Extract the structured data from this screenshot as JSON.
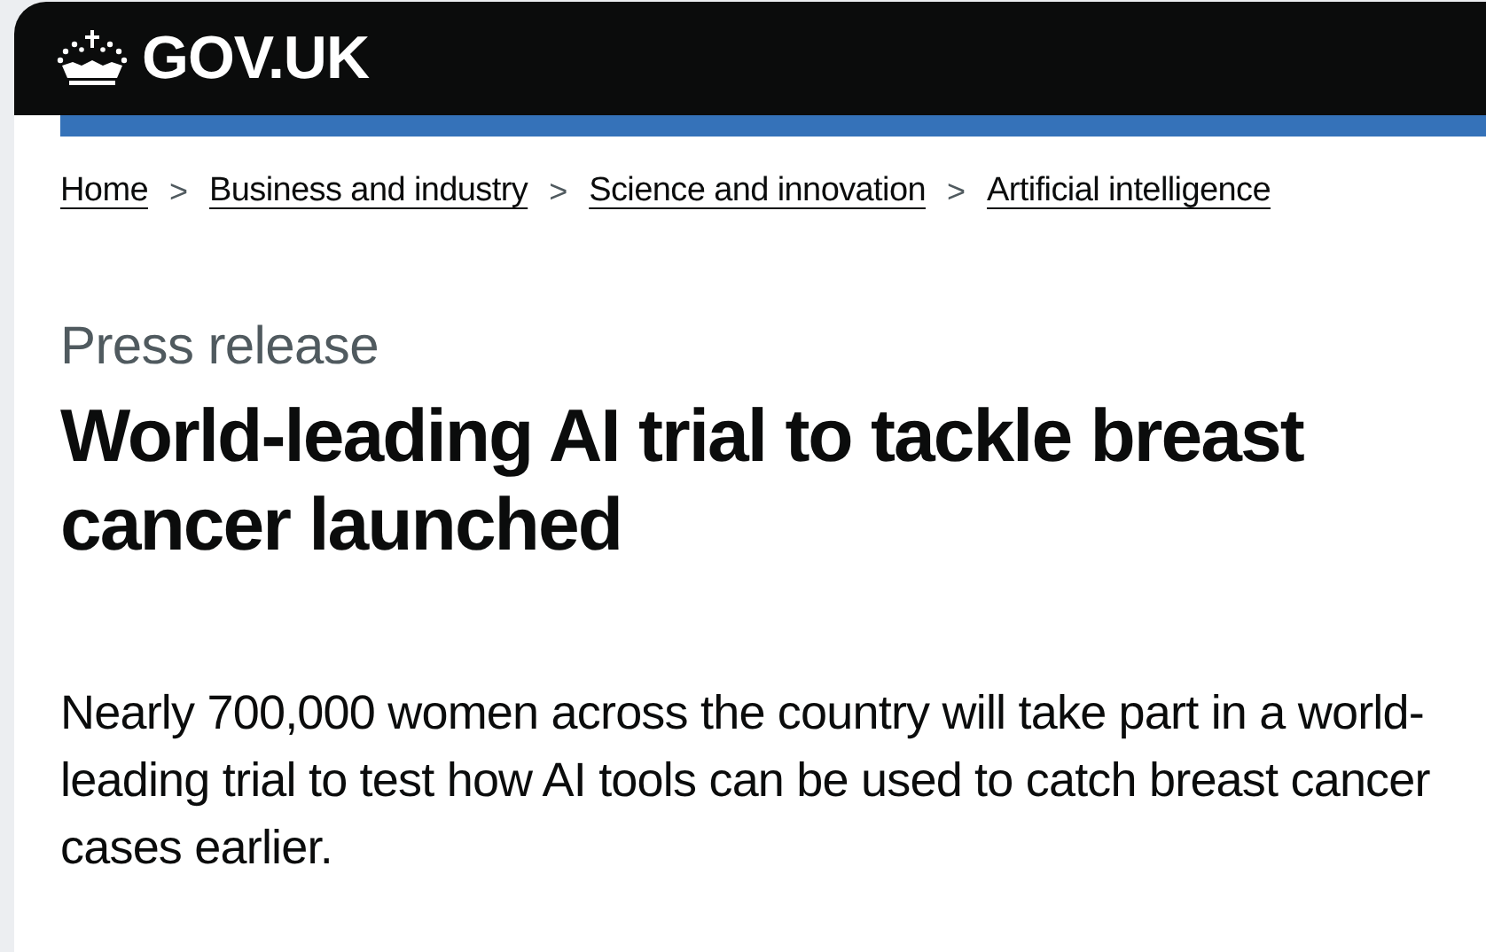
{
  "header": {
    "logo_text": "GOV.UK"
  },
  "breadcrumbs": [
    {
      "label": "Home"
    },
    {
      "label": "Business and industry"
    },
    {
      "label": "Science and innovation"
    },
    {
      "label": "Artificial intelligence"
    }
  ],
  "breadcrumb_separator": ">",
  "caption": "Press release",
  "title": "World-leading AI trial to tackle breast cancer launched",
  "lead": "Nearly 700,000 women across the country will take part in a world-leading trial to test how AI tools can be used to catch breast cancer cases earlier."
}
